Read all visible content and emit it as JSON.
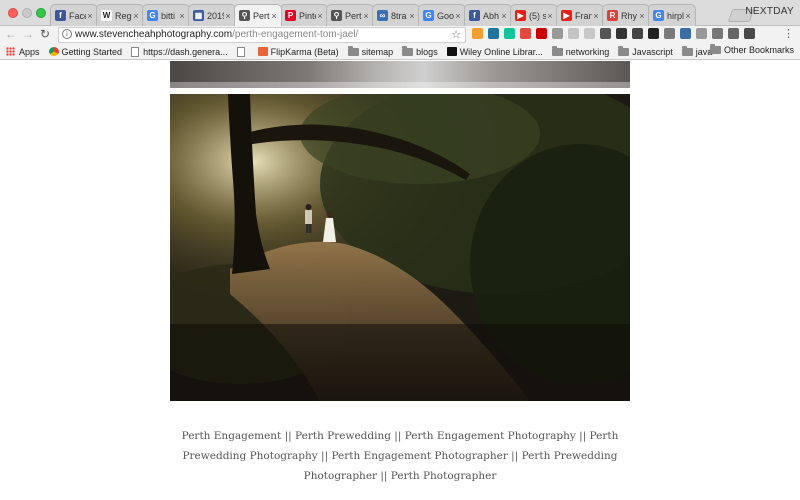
{
  "browser": {
    "profile_name": "NEXTDAY",
    "tabs": [
      {
        "label": "Face",
        "favicon": "facebook-favicon",
        "color": "#3b5998",
        "glyph": "f",
        "active": false
      },
      {
        "label": "Regi",
        "favicon": "wikipedia-favicon",
        "color": "#ffffff",
        "glyph": "W",
        "active": false
      },
      {
        "label": "bitti",
        "favicon": "google-favicon",
        "color": "#4285f4",
        "glyph": "G",
        "active": false
      },
      {
        "label": "2019",
        "favicon": "calendar-favicon",
        "color": "#3a5ba0",
        "glyph": "▦",
        "active": false
      },
      {
        "label": "Pert",
        "favicon": "location-pin-favicon",
        "color": "#555555",
        "glyph": "⚲",
        "active": true
      },
      {
        "label": "Pinte",
        "favicon": "pinterest-favicon",
        "color": "#e60023",
        "glyph": "P",
        "active": false
      },
      {
        "label": "Pert",
        "favicon": "location-pin-favicon",
        "color": "#555555",
        "glyph": "⚲",
        "active": false
      },
      {
        "label": "8tra",
        "favicon": "link-favicon",
        "color": "#3d6fb5",
        "glyph": "∞",
        "active": false
      },
      {
        "label": "Goo",
        "favicon": "google-favicon",
        "color": "#4285f4",
        "glyph": "G",
        "active": false
      },
      {
        "label": "Abh",
        "favicon": "facebook-favicon",
        "color": "#3b5998",
        "glyph": "f",
        "active": false
      },
      {
        "label": "(5) s",
        "favicon": "youtube-favicon",
        "color": "#e62117",
        "glyph": "▶",
        "active": false
      },
      {
        "label": "Fran",
        "favicon": "youtube-favicon",
        "color": "#e62117",
        "glyph": "▶",
        "active": false
      },
      {
        "label": "Rhy",
        "favicon": "r-favicon",
        "color": "#d9413c",
        "glyph": "R",
        "active": false
      },
      {
        "label": "hirpl",
        "favicon": "google-favicon",
        "color": "#4285f4",
        "glyph": "G",
        "active": false
      }
    ],
    "address": {
      "domain": "www.stevencheahphotography.com",
      "path": "/perth-engagement-tom-jael/"
    },
    "bookmarks": [
      {
        "label": "Apps",
        "type": "apps"
      },
      {
        "label": "Getting Started",
        "type": "chrome"
      },
      {
        "label": "https://dash.genera...",
        "type": "page"
      },
      {
        "label": "",
        "type": "page"
      },
      {
        "label": "FlipKarma (Beta)",
        "type": "flipkarma"
      },
      {
        "label": "sitemap",
        "type": "folder"
      },
      {
        "label": "blogs",
        "type": "folder"
      },
      {
        "label": "Wiley Online Librar...",
        "type": "wiley"
      },
      {
        "label": "networking",
        "type": "folder"
      },
      {
        "label": "Javascript",
        "type": "folder"
      },
      {
        "label": "java",
        "type": "folder"
      }
    ],
    "bookmarks_overflow": "»",
    "other_bookmarks": "Other Bookmarks",
    "extension_colors": [
      "#f0a030",
      "#21759b",
      "#15c39a",
      "#e04a3f",
      "#cc0000",
      "#999999",
      "#c4c4c4",
      "#c8c8c8",
      "#555555",
      "#333333",
      "#444444",
      "#222222",
      "#7a7a7a",
      "#3a6ea5",
      "#999999",
      "#777777",
      "#666666",
      "#4a4a4a"
    ]
  },
  "page": {
    "caption": "Perth Engagement || Perth Prewedding || Perth Engagement Photography || Perth Prewedding Photography || Perth Engagement Photographer || Perth Prewedding Photographer || Perth Photographer"
  }
}
